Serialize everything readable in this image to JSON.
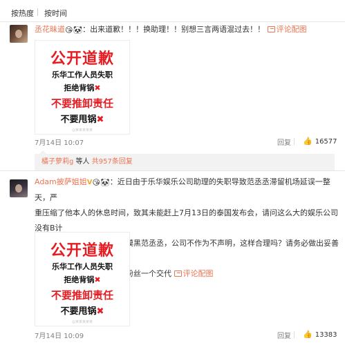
{
  "sort_bar": {
    "hot_label": "按热度",
    "time_label": "按时间"
  },
  "comments": [
    {
      "username": "丞花昧道",
      "emojis": "😘🐼",
      "text": "：出来道歉！！！换助理！！别想三言两语混过去！！",
      "pic_link": "评论配图",
      "image": {
        "line1": "公开道歉",
        "line2": "乐华工作人员失职",
        "line3": "拒绝背锅",
        "line4": "不要推卸责任",
        "line5": "不要甩锅",
        "watermark": "@某某某某某"
      },
      "date": "7月14日 10:07",
      "reply_label": "回复",
      "like_count": "16577",
      "reply_summary": {
        "name": "橘子萝莉g",
        "text": "等人",
        "count": "共957条回复"
      }
    },
    {
      "username": "Adam披萨姐姐",
      "badge": "V",
      "emojis": "😘🐼",
      "text_line1": "：近日由于乐华娱乐公司助理的失职导致范丞丞滞留机场延误一整天，严",
      "text_line2": "重压缩了他本人的休息时间，致其未能赶上7月13日的泰国发布会，请问这么大的娱乐公司没有B计",
      "text_line3": "划吗？并且面对营销号故意摸黑范丞丞，公司不作为不声明，这样合理吗？请务必做出妥善处置，",
      "text_line4": "还范丞丞先生清白，给所有粉丝一个交代",
      "pic_link": "评论配图",
      "image": {
        "line1": "公开道歉",
        "line2": "乐华工作人员失职",
        "line3": "拒绝背锅",
        "line4": "不要推卸责任",
        "line5": "不要甩锅",
        "watermark": "@某某某某某"
      },
      "date": "7月14日 10:09",
      "reply_label": "回复",
      "like_count": "13383"
    }
  ],
  "icons": {
    "like": "thumbs-up-icon",
    "picture": "picture-icon",
    "cross": "red-x-icon"
  },
  "colors": {
    "link": "#eb7350",
    "sticker_red": "#e41c23",
    "meta_gray": "#808080"
  }
}
